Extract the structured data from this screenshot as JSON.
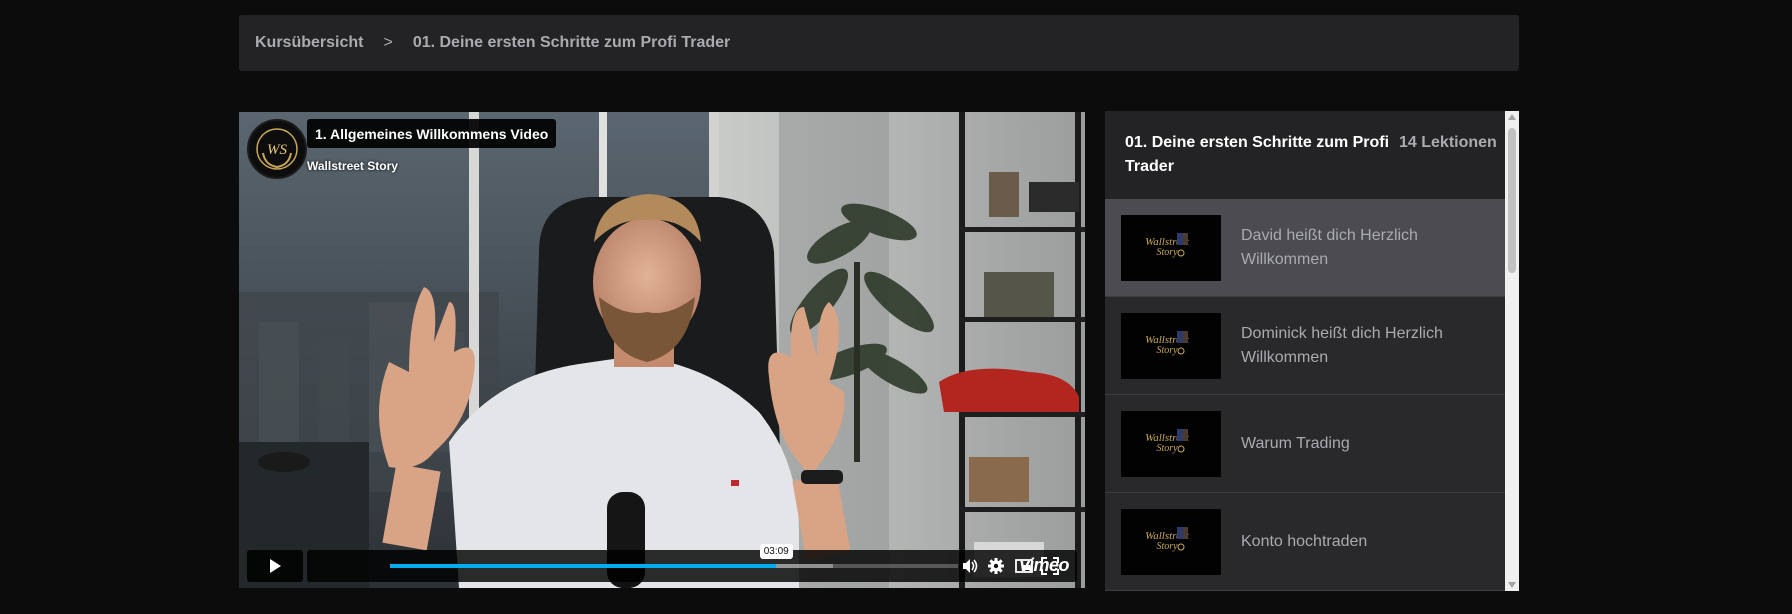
{
  "breadcrumb": {
    "course_overview": "Kursübersicht",
    "separator": ">",
    "current": "01. Deine ersten Schritte zum Profi Trader"
  },
  "player": {
    "title": "1. Allgemeines Willkommens Video",
    "channel": "Wallstreet Story",
    "logo_monogram": "WS",
    "time_tooltip": "03:09",
    "progress_fraction": 0.68,
    "buffered_fraction": 0.78,
    "provider": "vimeo",
    "accent_color": "#00adef",
    "icons": [
      "play-icon",
      "volume-icon",
      "settings-icon",
      "picture-in-picture-icon",
      "fullscreen-icon"
    ]
  },
  "sidebar": {
    "title": "01. Deine ersten Schritte zum Profi Trader",
    "count": "14 Lektionen",
    "thumbnail_brand_line1": "Wallstreet",
    "thumbnail_brand_line2": "Story",
    "lessons": [
      {
        "label": "David heißt dich Herzlich Willkommen",
        "active": true
      },
      {
        "label": "Dominick heißt dich Herzlich Willkommen",
        "active": false
      },
      {
        "label": "Warum Trading",
        "active": false
      },
      {
        "label": "Konto hochtraden",
        "active": false
      }
    ]
  }
}
